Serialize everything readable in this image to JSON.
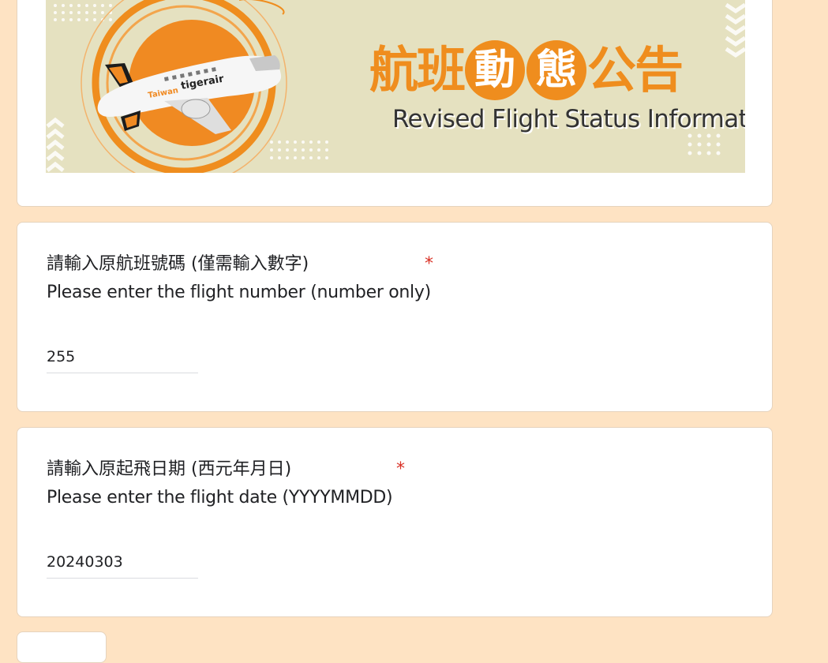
{
  "banner": {
    "logo_brand": "tigerair",
    "logo_prefix": "Taiwan",
    "title_chars": [
      "航",
      "班",
      "動",
      "態",
      "公",
      "告"
    ],
    "title_circled": [
      false,
      false,
      true,
      true,
      false,
      false
    ],
    "subtitle": "Revised Flight Status Information",
    "colors": {
      "background": "#e5e1c0",
      "accent": "#ef8d1e",
      "text": "#333333"
    }
  },
  "questions": [
    {
      "label_zh": "請輸入原航班號碼 (僅需輸入數字)",
      "label_en": "Please enter the flight number (number only)",
      "required_mark": "*",
      "value": "255"
    },
    {
      "label_zh": "請輸入原起飛日期 (西元年月日)",
      "label_en": "Please enter the flight date (YYYYMMDD)",
      "required_mark": "*",
      "value": "20240303"
    }
  ],
  "colors": {
    "page_background": "#fee3c3",
    "card_background": "#ffffff",
    "required": "#d93025"
  }
}
